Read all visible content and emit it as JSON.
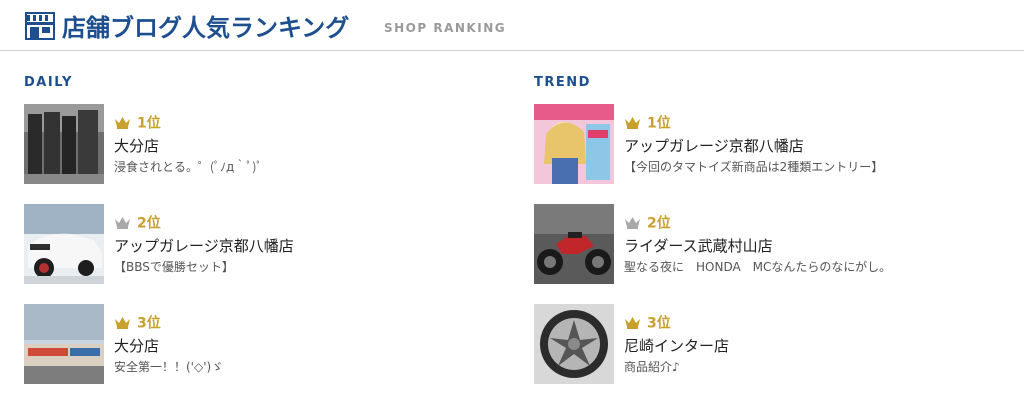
{
  "header": {
    "title": "店舗ブログ人気ランキング",
    "subtitle": "SHOP RANKING",
    "icon": "shop-icon",
    "accent_color": "#1d4f8f"
  },
  "daily": {
    "heading": "DAILY",
    "items": [
      {
        "rank": "1位",
        "shop": "大分店",
        "post": "浸食されとる。゜(ﾟﾉд｀ﾟ)ﾟ",
        "crown": "gold"
      },
      {
        "rank": "2位",
        "shop": "アップガレージ京都八幡店",
        "post": "【BBSで優勝セット】",
        "crown": "silver"
      },
      {
        "rank": "3位",
        "shop": "大分店",
        "post": "安全第一！！('◇')ゞ",
        "crown": "bronze"
      }
    ]
  },
  "trend": {
    "heading": "TREND",
    "items": [
      {
        "rank": "1位",
        "shop": "アップガレージ京都八幡店",
        "post": "【今回のタマトイズ新商品は2種類エントリー】",
        "crown": "gold"
      },
      {
        "rank": "2位",
        "shop": "ライダース武蔵村山店",
        "post": "聖なる夜に　HONDA　MCなんたらのなにがし。",
        "crown": "silver"
      },
      {
        "rank": "3位",
        "shop": "尼崎インター店",
        "post": "商品紹介♪",
        "crown": "bronze"
      }
    ]
  },
  "colors": {
    "gold": "#c8a02c",
    "silver": "#a9a9a9",
    "bronze": "#c8a02c"
  }
}
